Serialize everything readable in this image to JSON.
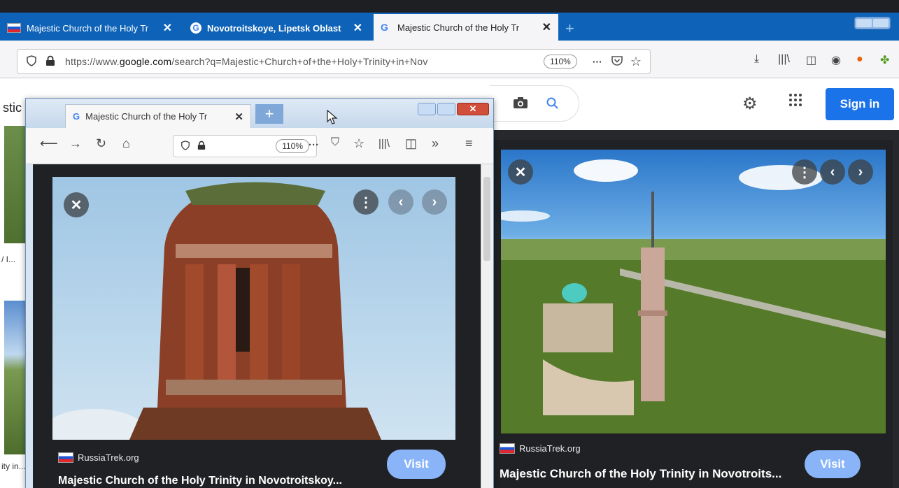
{
  "main_browser": {
    "tabs": [
      {
        "label": "Majestic Church of the Holy Tr",
        "icon": "russia-flag-icon"
      },
      {
        "label": "Novotroitskoye, Lipetsk Oblast",
        "icon": "google-icon"
      },
      {
        "label": "Majestic Church of the Holy Tr",
        "icon": "google-icon",
        "active": true
      }
    ],
    "close_glyph": "✕",
    "url_prefix": "https://www.",
    "url_host": "google.com",
    "url_rest": "/search?q=Majestic+Church+of+the+Holy+Trinity+in+Nov",
    "zoom": "110%",
    "more_glyph": "···"
  },
  "google": {
    "sign_in": "Sign in",
    "left_fragment": "stic",
    "left_snippets": [
      "/ I...",
      "ity in..."
    ]
  },
  "right_viewer": {
    "source": "RussiaTrek.org",
    "title": "Majestic Church of the Holy Trinity in Novotroits...",
    "visit": "Visit"
  },
  "small_window": {
    "tab_label": "Majestic Church of the Holy Tr",
    "zoom": "110%",
    "source": "RussiaTrek.org",
    "title": "Majestic Church of the Holy Trinity in Novotroitskoy...",
    "visit": "Visit"
  },
  "colors": {
    "tab_bar": "#0e63b8",
    "google_blue": "#1a73e8",
    "visit_button": "#8ab4f8",
    "dark_panel": "#202124"
  }
}
